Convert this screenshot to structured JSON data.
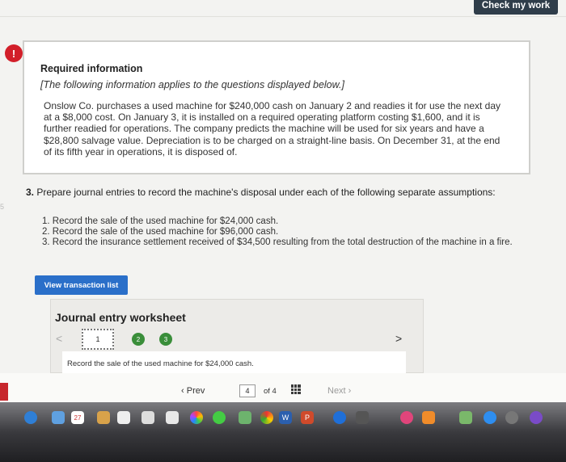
{
  "header": {
    "check_button": "Check my work"
  },
  "alert_icon": "!",
  "info": {
    "title": "Required information",
    "subtitle": "[The following information applies to the questions displayed below.]",
    "body": "Onslow Co. purchases a used machine for $240,000 cash on January 2 and readies it for use the next day at a $8,000 cost. On January 3, it is installed on a required operating platform costing $1,600, and it is further readied for operations. The company predicts the machine will be used for six years and have a $28,800 salvage value. Depreciation is to be charged on a straight-line basis. On December 31, at the end of its fifth year in operations, it is disposed of."
  },
  "question": {
    "number": "3.",
    "text": "Prepare journal entries to record the machine's disposal under each of the following separate assumptions:",
    "items": [
      "1. Record the sale of the used machine for $24,000 cash.",
      "2. Record the sale of the used machine for $96,000 cash.",
      "3. Record the insurance settlement received of $34,500 resulting from the total destruction of the machine in a fire."
    ]
  },
  "side_mark": "5",
  "view_button": "View transaction list",
  "worksheet": {
    "title": "Journal entry worksheet",
    "steps": [
      "1",
      "2",
      "3"
    ],
    "description": "Record the sale of the used machine for $24,000 cash."
  },
  "pagination": {
    "prev": "Prev",
    "current": "4",
    "of_label": "of 4",
    "next": "Next"
  },
  "dock": {
    "calendar_day": "27",
    "icons": [
      "finder-icon",
      "calendar-icon",
      "notes-icon",
      "reminders-icon",
      "photos-icon",
      "messages-icon",
      "chrome-icon",
      "word-icon",
      "powerpoint-icon",
      "quicktime-icon",
      "imovie-icon",
      "itunes-icon",
      "books-icon",
      "appstore-icon",
      "system-preferences-icon"
    ]
  },
  "colors": {
    "accent": "#2a6fc9",
    "check_button_bg": "#2f3d4a",
    "alert": "#d21f2a",
    "step_green": "#3a8e3a"
  }
}
